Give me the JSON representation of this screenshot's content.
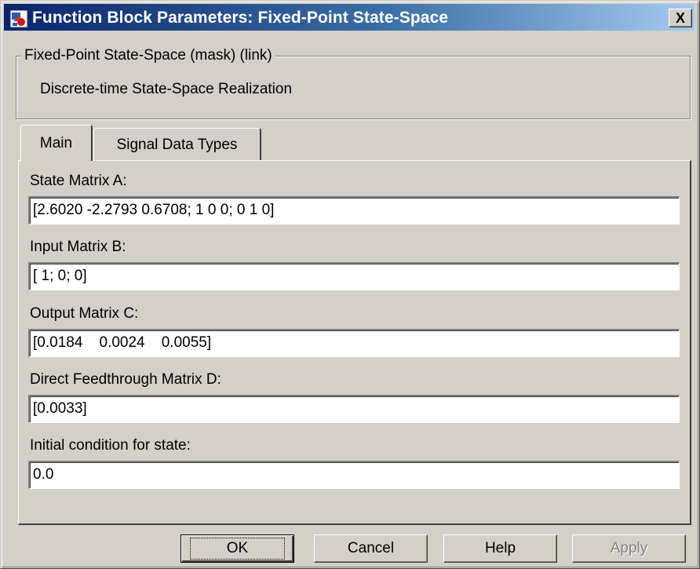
{
  "window": {
    "title": "Function Block Parameters: Fixed-Point State-Space",
    "close_label": "X",
    "app_icon": "simulink-block-icon"
  },
  "description_group": {
    "legend": "Fixed-Point State-Space (mask) (link)",
    "text": "Discrete-time State-Space Realization"
  },
  "tabs": [
    {
      "label": "Main",
      "selected": true
    },
    {
      "label": "Signal Data Types",
      "selected": false
    }
  ],
  "parameters": [
    {
      "label": "State Matrix A:",
      "value": "[2.6020 -2.2793 0.6708; 1 0 0; 0 1 0]"
    },
    {
      "label": "Input Matrix B:",
      "value": "[ 1; 0; 0]"
    },
    {
      "label": "Output Matrix C:",
      "value": "[0.0184    0.0024    0.0055]"
    },
    {
      "label": "Direct Feedthrough Matrix D:",
      "value": "[0.0033]"
    },
    {
      "label": "Initial condition for state:",
      "value": "0.0"
    }
  ],
  "buttons": {
    "ok": "OK",
    "cancel": "Cancel",
    "help": "Help",
    "apply": "Apply",
    "apply_enabled": false
  }
}
